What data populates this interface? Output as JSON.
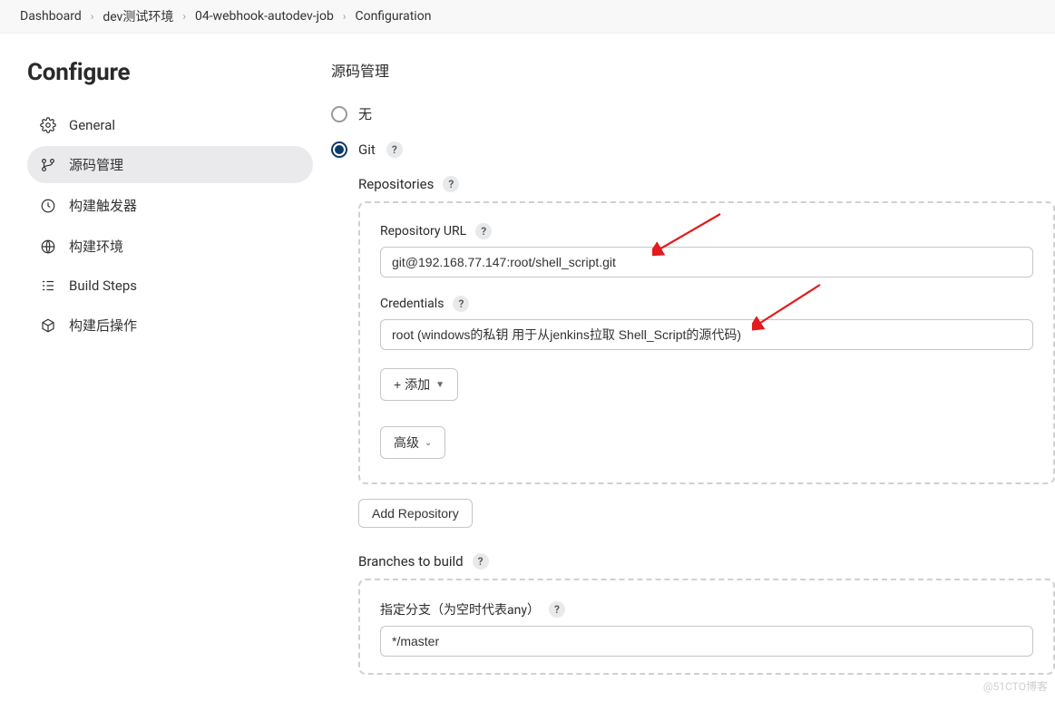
{
  "breadcrumbs": [
    "Dashboard",
    "dev测试环境",
    "04-webhook-autodev-job",
    "Configuration"
  ],
  "sidebar": {
    "title": "Configure",
    "items": [
      {
        "label": "General"
      },
      {
        "label": "源码管理"
      },
      {
        "label": "构建触发器"
      },
      {
        "label": "构建环境"
      },
      {
        "label": "Build Steps"
      },
      {
        "label": "构建后操作"
      }
    ]
  },
  "main": {
    "section_title": "源码管理",
    "option_none": "无",
    "option_git": "Git",
    "repositories_label": "Repositories",
    "repo_url_label": "Repository URL",
    "repo_url_value": "git@192.168.77.147:root/shell_script.git",
    "credentials_label": "Credentials",
    "credentials_value": "root (windows的私钥 用于从jenkins拉取 Shell_Script的源代码)",
    "add_credentials_btn": "+ 添加",
    "advanced_btn": "高级",
    "add_repository_btn": "Add Repository",
    "branches_label": "Branches to build",
    "branch_specifier_label": "指定分支（为空时代表any）",
    "branch_value": "*/master"
  },
  "watermark": "@51CTO博客"
}
